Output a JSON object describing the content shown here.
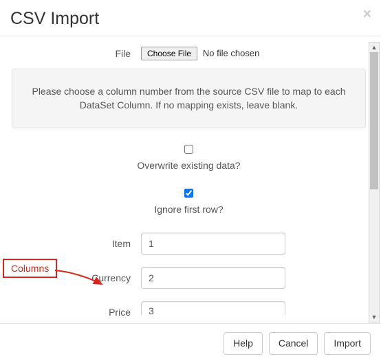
{
  "header": {
    "title": "CSV Import"
  },
  "file": {
    "label": "File",
    "button": "Choose File",
    "status": "No file chosen"
  },
  "info_text": "Please choose a column number from the source CSV file to map to each DataSet Column. If no mapping exists, leave blank.",
  "checkboxes": {
    "overwrite": {
      "label": "Overwrite existing data?",
      "checked": false
    },
    "ignore_first": {
      "label": "Ignore first row?",
      "checked": true
    }
  },
  "columns": [
    {
      "label": "Item",
      "value": "1"
    },
    {
      "label": "Currency",
      "value": "2"
    },
    {
      "label": "Price",
      "value": "3"
    }
  ],
  "footer": {
    "help": "Help",
    "cancel": "Cancel",
    "import": "Import"
  },
  "annotation": {
    "label": "Columns"
  }
}
